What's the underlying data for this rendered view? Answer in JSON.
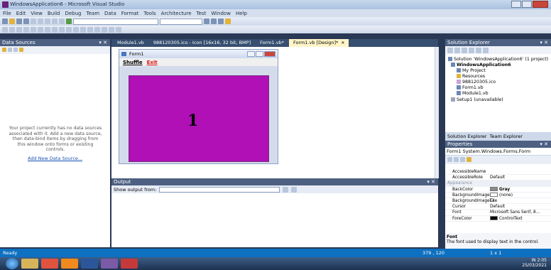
{
  "window": {
    "title": "WindowsApplication6 - Microsoft Visual Studio"
  },
  "menu": [
    "File",
    "Edit",
    "View",
    "Build",
    "Debug",
    "Team",
    "Data",
    "Format",
    "Tools",
    "Architecture",
    "Test",
    "Window",
    "Help"
  ],
  "data_sources": {
    "title": "Data Sources",
    "message": "Your project currently has no data sources associated with it. Add a new data source, then data-bind items by dragging from this window onto forms or existing controls.",
    "link": "Add New Data Source..."
  },
  "doc_tabs": [
    "Module1.vb",
    "988120305.ico - Icon [16x16, 32 bit, BMP]",
    "Form1.vb*",
    "Form1.vb [Design]*"
  ],
  "form": {
    "title": "Form1",
    "menu_shuffle": "Shuffle",
    "menu_exit": "Exit",
    "tile_text": "1"
  },
  "output": {
    "title": "Output",
    "show_from_label": "Show output from:"
  },
  "solution_explorer": {
    "title": "Solution Explorer",
    "solution": "Solution 'WindowsApplication6' (1 project)",
    "project": "WindowsApplication6",
    "items": [
      "My Project",
      "Resources",
      "988120305.ico",
      "Form1.vb",
      "Module1.vb"
    ],
    "setup": "Setup1 (unavailable)",
    "tab_se": "Solution Explorer",
    "tab_te": "Team Explorer"
  },
  "properties": {
    "title": "Properties",
    "object": "Form1 System.Windows.Forms.Form",
    "rows": [
      {
        "name": "AccessibleName",
        "value": ""
      },
      {
        "name": "AccessibleRole",
        "value": "Default"
      },
      {
        "name": "Appearance",
        "value": "",
        "category": true
      },
      {
        "name": "BackColor",
        "value": "Gray",
        "swatch": "#8a8a8a"
      },
      {
        "name": "BackgroundImage",
        "value": "(none)",
        "swatch": "#ffffff"
      },
      {
        "name": "BackgroundImageLa",
        "value": "Tile"
      },
      {
        "name": "Cursor",
        "value": "Default"
      },
      {
        "name": "Font",
        "value": "Microsoft Sans Serif, 8..."
      },
      {
        "name": "ForeColor",
        "value": "ControlText",
        "swatch": "#000000"
      }
    ],
    "desc_title": "Font",
    "desc_text": "The font used to display text in the control."
  },
  "status": {
    "left": "Ready",
    "coords": "379 , 120",
    "size": "1 x 1"
  },
  "tray": {
    "time": "2:05",
    "date": "25/03/2021",
    "lang": "IN"
  },
  "colors": {
    "form_background": "#b010b6",
    "status_bar": "#0e70c0"
  }
}
